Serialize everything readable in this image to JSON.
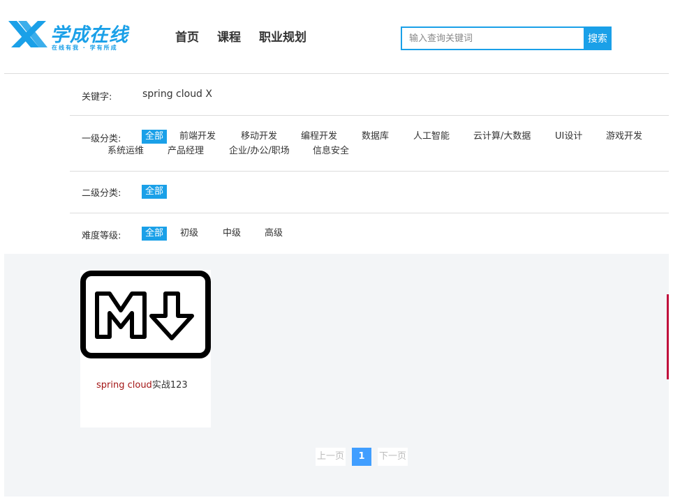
{
  "logo": {
    "text": "学成在线",
    "slogan": "在线有我 · 学有所成"
  },
  "nav": [
    "首页",
    "课程",
    "职业规划"
  ],
  "search": {
    "placeholder": "输入查询关键词",
    "button": "搜索"
  },
  "filters": {
    "keyword": {
      "label": "关键字:",
      "value": "spring cloud X"
    },
    "cat1": {
      "label": "一级分类:",
      "options": [
        "全部",
        "前端开发",
        "移动开发",
        "编程开发",
        "数据库",
        "人工智能",
        "云计算/大数据",
        "UI设计",
        "游戏开发",
        "系统运维",
        "产品经理",
        "企业/办公/职场",
        "信息安全"
      ]
    },
    "cat2": {
      "label": "二级分类:",
      "options": [
        "全部"
      ]
    },
    "level": {
      "label": "难度等级:",
      "options": [
        "全部",
        "初级",
        "中级",
        "高级"
      ]
    }
  },
  "course": {
    "title_highlight": "spring cloud",
    "title_rest": "实战123",
    "image_icon": "markdown-logo-icon"
  },
  "pager": {
    "prev": "上一页",
    "current": "1",
    "next": "下一页"
  },
  "colors": {
    "accent": "#1aa0e8",
    "pager_active": "#409eff",
    "highlight": "#a31515"
  }
}
